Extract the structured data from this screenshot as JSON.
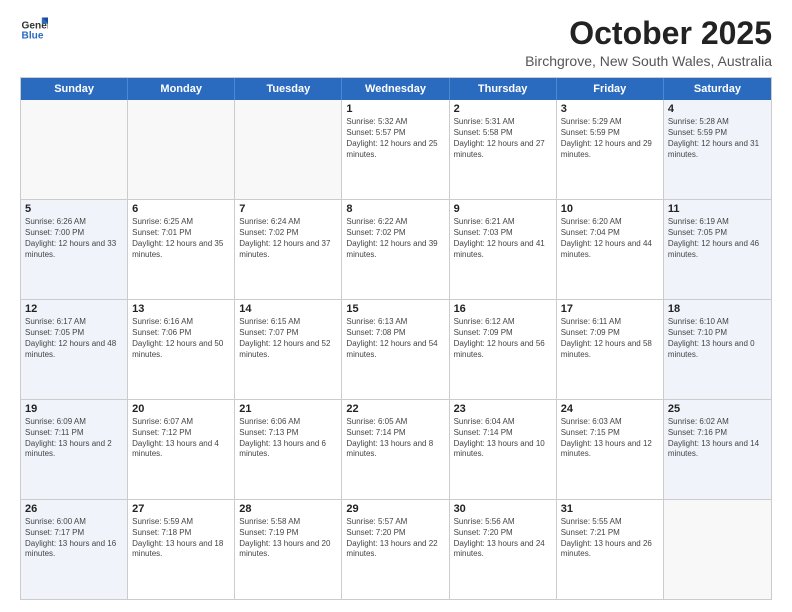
{
  "logo": {
    "line1": "General",
    "line2": "Blue"
  },
  "title": "October 2025",
  "subtitle": "Birchgrove, New South Wales, Australia",
  "days": [
    "Sunday",
    "Monday",
    "Tuesday",
    "Wednesday",
    "Thursday",
    "Friday",
    "Saturday"
  ],
  "weeks": [
    [
      {
        "day": "",
        "empty": true
      },
      {
        "day": "",
        "empty": true
      },
      {
        "day": "",
        "empty": true
      },
      {
        "day": "1",
        "sunrise": "5:32 AM",
        "sunset": "5:57 PM",
        "daylight": "12 hours and 25 minutes."
      },
      {
        "day": "2",
        "sunrise": "5:31 AM",
        "sunset": "5:58 PM",
        "daylight": "12 hours and 27 minutes."
      },
      {
        "day": "3",
        "sunrise": "5:29 AM",
        "sunset": "5:59 PM",
        "daylight": "12 hours and 29 minutes."
      },
      {
        "day": "4",
        "sunrise": "5:28 AM",
        "sunset": "5:59 PM",
        "daylight": "12 hours and 31 minutes."
      }
    ],
    [
      {
        "day": "5",
        "sunrise": "6:26 AM",
        "sunset": "7:00 PM",
        "daylight": "12 hours and 33 minutes."
      },
      {
        "day": "6",
        "sunrise": "6:25 AM",
        "sunset": "7:01 PM",
        "daylight": "12 hours and 35 minutes."
      },
      {
        "day": "7",
        "sunrise": "6:24 AM",
        "sunset": "7:02 PM",
        "daylight": "12 hours and 37 minutes."
      },
      {
        "day": "8",
        "sunrise": "6:22 AM",
        "sunset": "7:02 PM",
        "daylight": "12 hours and 39 minutes."
      },
      {
        "day": "9",
        "sunrise": "6:21 AM",
        "sunset": "7:03 PM",
        "daylight": "12 hours and 41 minutes."
      },
      {
        "day": "10",
        "sunrise": "6:20 AM",
        "sunset": "7:04 PM",
        "daylight": "12 hours and 44 minutes."
      },
      {
        "day": "11",
        "sunrise": "6:19 AM",
        "sunset": "7:05 PM",
        "daylight": "12 hours and 46 minutes."
      }
    ],
    [
      {
        "day": "12",
        "sunrise": "6:17 AM",
        "sunset": "7:05 PM",
        "daylight": "12 hours and 48 minutes."
      },
      {
        "day": "13",
        "sunrise": "6:16 AM",
        "sunset": "7:06 PM",
        "daylight": "12 hours and 50 minutes."
      },
      {
        "day": "14",
        "sunrise": "6:15 AM",
        "sunset": "7:07 PM",
        "daylight": "12 hours and 52 minutes."
      },
      {
        "day": "15",
        "sunrise": "6:13 AM",
        "sunset": "7:08 PM",
        "daylight": "12 hours and 54 minutes."
      },
      {
        "day": "16",
        "sunrise": "6:12 AM",
        "sunset": "7:09 PM",
        "daylight": "12 hours and 56 minutes."
      },
      {
        "day": "17",
        "sunrise": "6:11 AM",
        "sunset": "7:09 PM",
        "daylight": "12 hours and 58 minutes."
      },
      {
        "day": "18",
        "sunrise": "6:10 AM",
        "sunset": "7:10 PM",
        "daylight": "13 hours and 0 minutes."
      }
    ],
    [
      {
        "day": "19",
        "sunrise": "6:09 AM",
        "sunset": "7:11 PM",
        "daylight": "13 hours and 2 minutes."
      },
      {
        "day": "20",
        "sunrise": "6:07 AM",
        "sunset": "7:12 PM",
        "daylight": "13 hours and 4 minutes."
      },
      {
        "day": "21",
        "sunrise": "6:06 AM",
        "sunset": "7:13 PM",
        "daylight": "13 hours and 6 minutes."
      },
      {
        "day": "22",
        "sunrise": "6:05 AM",
        "sunset": "7:14 PM",
        "daylight": "13 hours and 8 minutes."
      },
      {
        "day": "23",
        "sunrise": "6:04 AM",
        "sunset": "7:14 PM",
        "daylight": "13 hours and 10 minutes."
      },
      {
        "day": "24",
        "sunrise": "6:03 AM",
        "sunset": "7:15 PM",
        "daylight": "13 hours and 12 minutes."
      },
      {
        "day": "25",
        "sunrise": "6:02 AM",
        "sunset": "7:16 PM",
        "daylight": "13 hours and 14 minutes."
      }
    ],
    [
      {
        "day": "26",
        "sunrise": "6:00 AM",
        "sunset": "7:17 PM",
        "daylight": "13 hours and 16 minutes."
      },
      {
        "day": "27",
        "sunrise": "5:59 AM",
        "sunset": "7:18 PM",
        "daylight": "13 hours and 18 minutes."
      },
      {
        "day": "28",
        "sunrise": "5:58 AM",
        "sunset": "7:19 PM",
        "daylight": "13 hours and 20 minutes."
      },
      {
        "day": "29",
        "sunrise": "5:57 AM",
        "sunset": "7:20 PM",
        "daylight": "13 hours and 22 minutes."
      },
      {
        "day": "30",
        "sunrise": "5:56 AM",
        "sunset": "7:20 PM",
        "daylight": "13 hours and 24 minutes."
      },
      {
        "day": "31",
        "sunrise": "5:55 AM",
        "sunset": "7:21 PM",
        "daylight": "13 hours and 26 minutes."
      },
      {
        "day": "",
        "empty": true
      }
    ]
  ]
}
